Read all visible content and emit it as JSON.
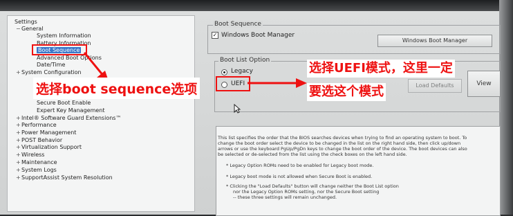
{
  "tree": {
    "items": [
      {
        "label": "Settings",
        "level": 0,
        "marker": ""
      },
      {
        "label": "General",
        "level": 1,
        "marker": "−"
      },
      {
        "label": "System Information",
        "level": 2,
        "marker": ""
      },
      {
        "label": "Battery Information",
        "level": 2,
        "marker": ""
      },
      {
        "label": "Boot Sequence",
        "level": 2,
        "marker": "",
        "selected": true
      },
      {
        "label": "Advanced Boot Options",
        "level": 2,
        "marker": ""
      },
      {
        "label": "Date/Time",
        "level": 2,
        "marker": ""
      },
      {
        "label": "System Configuration",
        "level": 1,
        "marker": "+"
      },
      {
        "label": "Secure Boot Enable",
        "level": 2,
        "marker": ""
      },
      {
        "label": "Expert Key Management",
        "level": 2,
        "marker": ""
      },
      {
        "label": "Intel® Software Guard Extensions™",
        "level": 1,
        "marker": "+"
      },
      {
        "label": "Performance",
        "level": 1,
        "marker": "+"
      },
      {
        "label": "Power Management",
        "level": 1,
        "marker": "+"
      },
      {
        "label": "POST Behavior",
        "level": 1,
        "marker": "+"
      },
      {
        "label": "Virtualization Support",
        "level": 1,
        "marker": "+"
      },
      {
        "label": "Wireless",
        "level": 1,
        "marker": "+"
      },
      {
        "label": "Maintenance",
        "level": 1,
        "marker": "+"
      },
      {
        "label": "System Logs",
        "level": 1,
        "marker": "+"
      },
      {
        "label": "SupportAssist System Resolution",
        "level": 1,
        "marker": "+"
      }
    ]
  },
  "boot_sequence": {
    "group_title": "Boot Sequence",
    "checkbox_label": "Windows Boot Manager",
    "checkbox_mark": "✓",
    "selected_button": "Windows Boot Manager"
  },
  "boot_list_option": {
    "group_title": "Boot List Option",
    "legacy_label": "Legacy",
    "uefi_label": "UEFI",
    "load_defaults_label": "Load Defaults",
    "view_label": "View"
  },
  "description": {
    "lines": [
      "This list specifies the order that the BIOS searches devices when trying to find an operating system to boot. To",
      "change the boot order select the device to be changed in the list on the right hand side, then click up/down",
      "arrows or use the keyboard PgUp/PgDn keys to change the boot order of the device. The boot devices can also",
      "be selected or de-selected from the list using the check boxes on the left hand side.",
      "* Legacy Option ROMs need to be enabled for Legacy boot mode.",
      "* Legacy boot mode is not allowed when Secure Boot is enabled.",
      "* Clicking the \"Load Defaults\" button will change neither the Boot List option",
      "nor the Legacy Option ROMs setting, nor the Secure Boot setting",
      "-- these three settings will remain unchanged."
    ]
  },
  "annotations": {
    "left_note": "选择boot sequence选项",
    "right_note_line1": "选择UEFI模式，这里一定",
    "right_note_line2": "要选这个模式"
  }
}
